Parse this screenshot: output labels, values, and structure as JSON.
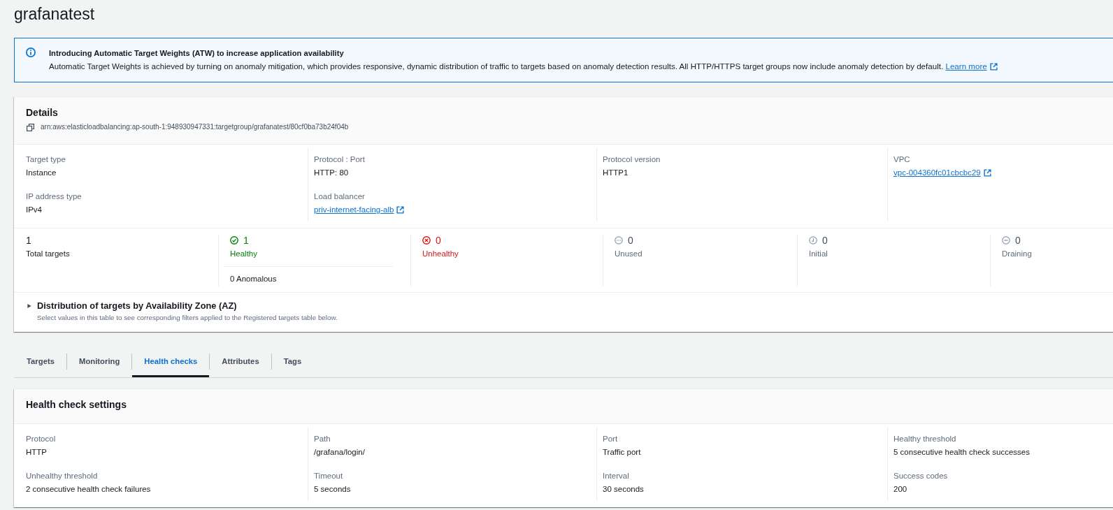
{
  "page": {
    "title": "grafanatest"
  },
  "flash": {
    "title": "Introducing Automatic Target Weights (ATW) to increase application availability",
    "message": "Automatic Target Weights is achieved by turning on anomaly mitigation, which provides responsive, dynamic distribution of traffic to targets based on anomaly detection results. All HTTP/HTTPS target groups now include anomaly detection by default.",
    "link": "Learn more"
  },
  "details": {
    "title": "Details",
    "arn": "arn:aws:elasticloadbalancing:ap-south-1:948930947331:targetgroup/grafanatest/80cf0ba73b24f04b",
    "columns": [
      [
        {
          "label": "Target type",
          "value": "Instance",
          "kind": "text"
        },
        {
          "label": "IP address type",
          "value": "IPv4",
          "kind": "text"
        }
      ],
      [
        {
          "label": "Protocol : Port",
          "value": "HTTP: 80",
          "kind": "text"
        },
        {
          "label": "Load balancer",
          "value": "priv-internet-facing-alb",
          "kind": "link"
        }
      ],
      [
        {
          "label": "Protocol version",
          "value": "HTTP1",
          "kind": "text"
        }
      ],
      [
        {
          "label": "VPC",
          "value": "vpc-004360fc01cbcbc29",
          "kind": "link"
        }
      ]
    ],
    "stats": [
      {
        "kind": "total",
        "count": "1",
        "label": "Total targets"
      },
      {
        "kind": "healthy",
        "count": "1",
        "label": "Healthy",
        "note": "0 Anomalous"
      },
      {
        "kind": "unhealthy",
        "count": "0",
        "label": "Unhealthy"
      },
      {
        "kind": "unused",
        "count": "0",
        "label": "Unused"
      },
      {
        "kind": "initial",
        "count": "0",
        "label": "Initial"
      },
      {
        "kind": "draining",
        "count": "0",
        "label": "Draining"
      }
    ],
    "distribution": {
      "expanded": false,
      "title": "Distribution of targets by Availability Zone (AZ)",
      "description": "Select values in this table to see corresponding filters applied to the Registered targets table below."
    }
  },
  "tabs": [
    {
      "label": "Targets",
      "selected": false
    },
    {
      "label": "Monitoring",
      "selected": false
    },
    {
      "label": "Health checks",
      "selected": true
    },
    {
      "label": "Attributes",
      "selected": false
    },
    {
      "label": "Tags",
      "selected": false
    }
  ],
  "health_check_settings": {
    "title": "Health check settings",
    "columns": [
      [
        {
          "label": "Protocol",
          "value": "HTTP",
          "kind": "text"
        },
        {
          "label": "Unhealthy threshold",
          "value": "2 consecutive health check failures",
          "kind": "text"
        }
      ],
      [
        {
          "label": "Path",
          "value": "/grafana/login/",
          "kind": "text"
        },
        {
          "label": "Timeout",
          "value": "5 seconds",
          "kind": "text"
        }
      ],
      [
        {
          "label": "Port",
          "value": "Traffic port",
          "kind": "text"
        },
        {
          "label": "Interval",
          "value": "30 seconds",
          "kind": "text"
        }
      ],
      [
        {
          "label": "Healthy threshold",
          "value": "5 consecutive health check successes",
          "kind": "text"
        },
        {
          "label": "Success codes",
          "value": "200",
          "kind": "text"
        }
      ]
    ]
  }
}
